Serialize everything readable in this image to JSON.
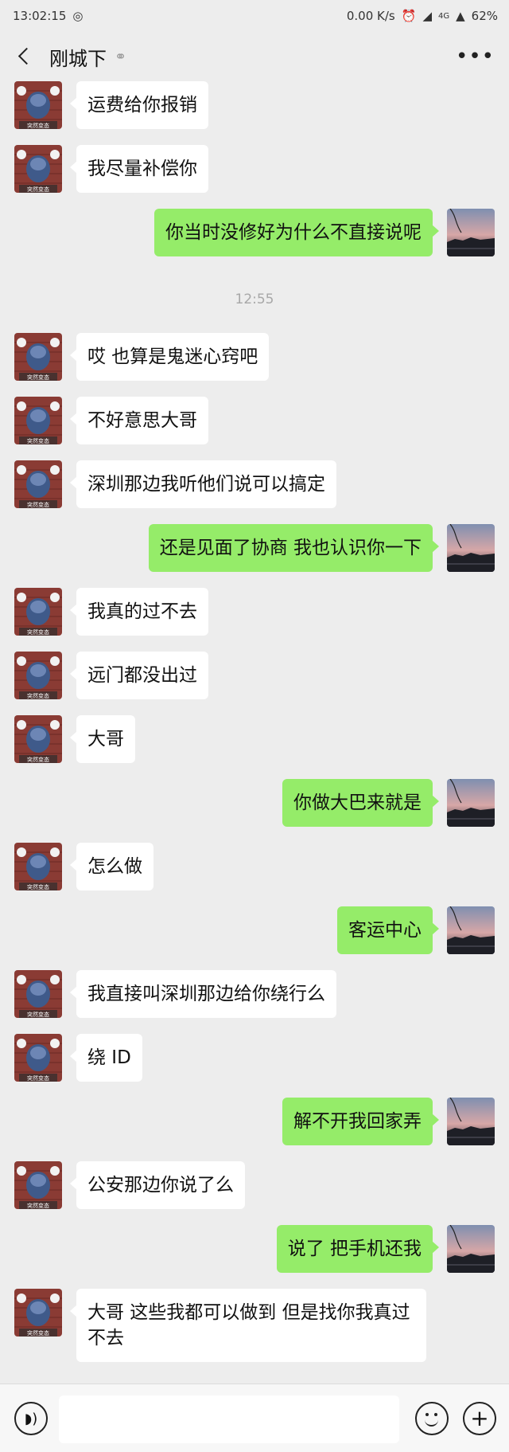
{
  "status_bar": {
    "time": "13:02:15",
    "net_speed": "0.00 K/s",
    "network": "4G",
    "battery": "62%"
  },
  "nav": {
    "title": "刚城下",
    "back_icon": "chevron-left-icon",
    "ear_icon": "ear-icon",
    "more_icon": "more-dots-icon"
  },
  "timestamp": "12:55",
  "messages": [
    {
      "side": "left",
      "text": "运费给你报销"
    },
    {
      "side": "left",
      "text": "我尽量补偿你"
    },
    {
      "side": "right",
      "text": "你当时没修好为什么不直接说呢"
    },
    {
      "side": "left",
      "text": "哎 也算是鬼迷心窍吧"
    },
    {
      "side": "left",
      "text": "不好意思大哥"
    },
    {
      "side": "left",
      "text": "深圳那边我听他们说可以搞定"
    },
    {
      "side": "right",
      "text": "还是见面了协商   我也认识你一下"
    },
    {
      "side": "left",
      "text": "我真的过不去"
    },
    {
      "side": "left",
      "text": "远门都没出过"
    },
    {
      "side": "left",
      "text": "大哥"
    },
    {
      "side": "right",
      "text": "你做大巴来就是"
    },
    {
      "side": "left",
      "text": "怎么做"
    },
    {
      "side": "right",
      "text": "客运中心"
    },
    {
      "side": "left",
      "text": "我直接叫深圳那边给你绕行么"
    },
    {
      "side": "left",
      "text": "绕 ID"
    },
    {
      "side": "right",
      "text": "解不开我回家弄"
    },
    {
      "side": "left",
      "text": "公安那边你说了么"
    },
    {
      "side": "right",
      "text": "说了  把手机还我"
    },
    {
      "side": "left",
      "text": "大哥 这些我都可以做到 但是找你我真过不去"
    }
  ],
  "avatar_caption": "突然变态",
  "input_bar": {
    "voice_icon": "voice-icon",
    "emoji_icon": "emoji-icon",
    "plus_icon": "plus-icon",
    "colors": {
      "self_bubble": "#95ec69",
      "other_bubble": "#ffffff",
      "background": "#ededed"
    }
  }
}
